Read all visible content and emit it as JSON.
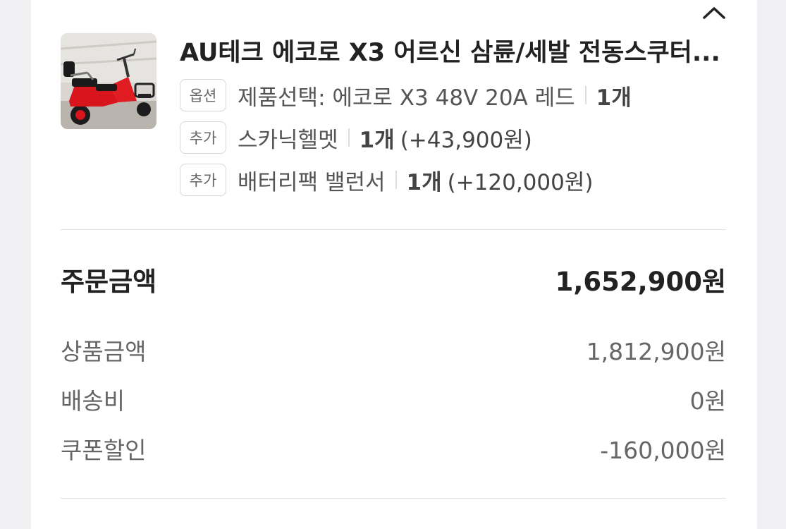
{
  "header": {
    "collapse_icon": "chevron-up-icon"
  },
  "product": {
    "image_icon": "electric-tricycle-image",
    "title": "AU테크 에코로 X3 어르신 삼륜/세발 전동스쿠터...",
    "options": [
      {
        "tag": "옵션",
        "name": "제품선택: 에코로 X3 48V 20A 레드",
        "qty": "1개",
        "price": ""
      },
      {
        "tag": "추가",
        "name": "스카닉헬멧",
        "qty": "1개",
        "price": "(+43,900원)"
      },
      {
        "tag": "추가",
        "name": "배터리팩 밸런서",
        "qty": "1개",
        "price": "(+120,000원)"
      }
    ]
  },
  "summary": {
    "order_total": {
      "label": "주문금액",
      "value": "1,652,900원"
    },
    "items": [
      {
        "label": "상품금액",
        "value": "1,812,900원"
      },
      {
        "label": "배송비",
        "value": "0원"
      },
      {
        "label": "쿠폰할인",
        "value": "-160,000원"
      }
    ]
  },
  "colors": {
    "background": "#f0f0f2",
    "card": "#ffffff",
    "text_primary": "#222222",
    "text_secondary": "#666666",
    "product_red": "#d8141c"
  }
}
